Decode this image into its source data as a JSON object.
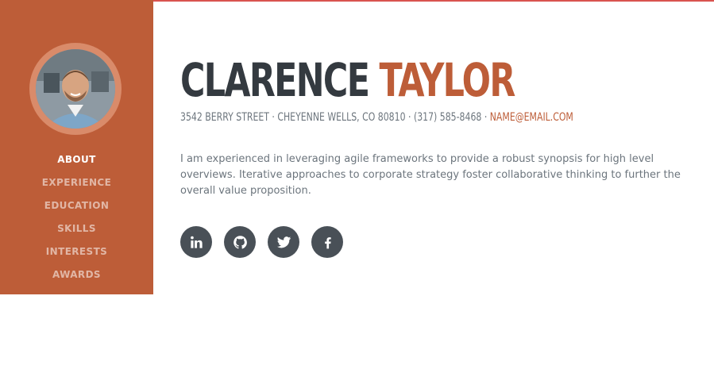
{
  "profile": {
    "first_name": "CLARENCE",
    "last_name": "TAYLOR",
    "address": "3542 BERRY STREET · CHEYENNE WELLS, CO 80810 · (317) 585-8468 · ",
    "email": "NAME@EMAIL.COM",
    "bio": "I am experienced in leveraging agile frameworks to provide a robust synopsis for high level overviews. Iterative approaches to corporate strategy foster collaborative thinking to further the overall value proposition."
  },
  "nav": {
    "items": [
      {
        "label": "ABOUT"
      },
      {
        "label": "EXPERIENCE"
      },
      {
        "label": "EDUCATION"
      },
      {
        "label": "SKILLS"
      },
      {
        "label": "INTERESTS"
      },
      {
        "label": "AWARDS"
      }
    ]
  },
  "social": [
    "linkedin-icon",
    "github-icon",
    "twitter-icon",
    "facebook-icon"
  ],
  "colors": {
    "accent": "#bd5d38",
    "dark": "#343a40",
    "text": "#6c757d",
    "icon_bg": "#495057"
  }
}
